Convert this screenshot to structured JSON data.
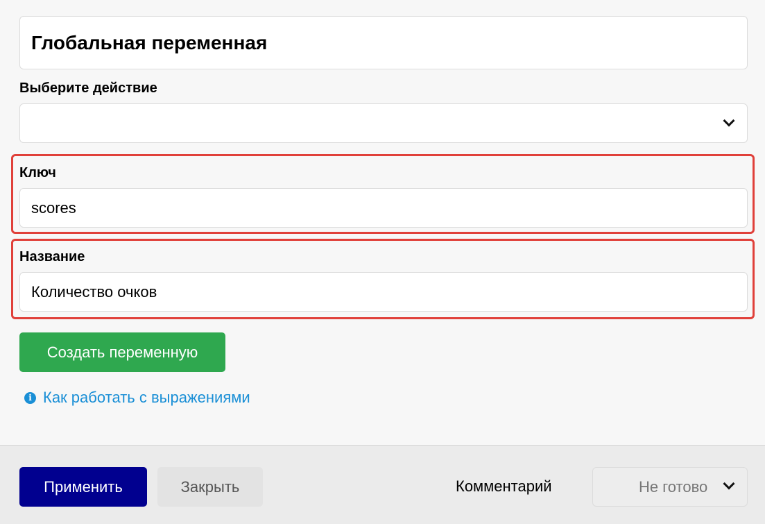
{
  "panel": {
    "title": "Глобальная переменная"
  },
  "action": {
    "label": "Выберите действие",
    "value": ""
  },
  "key": {
    "label": "Ключ",
    "value": "scores"
  },
  "name": {
    "label": "Название",
    "value": "Количество очков"
  },
  "create_button": {
    "label": "Создать переменную"
  },
  "help_link": {
    "label": "Как работать с выражениями"
  },
  "footer": {
    "apply_label": "Применить",
    "close_label": "Закрыть",
    "comment_label": "Комментарий",
    "status_value": "Не готово"
  },
  "colors": {
    "highlight": "#e0403a",
    "create_button": "#2fa84f",
    "apply_button": "#01008f",
    "link": "#1a8fd6"
  },
  "icons": {
    "action_chevron": "chevron-down-icon",
    "info": "info-icon",
    "status_chevron": "chevron-down-icon"
  }
}
